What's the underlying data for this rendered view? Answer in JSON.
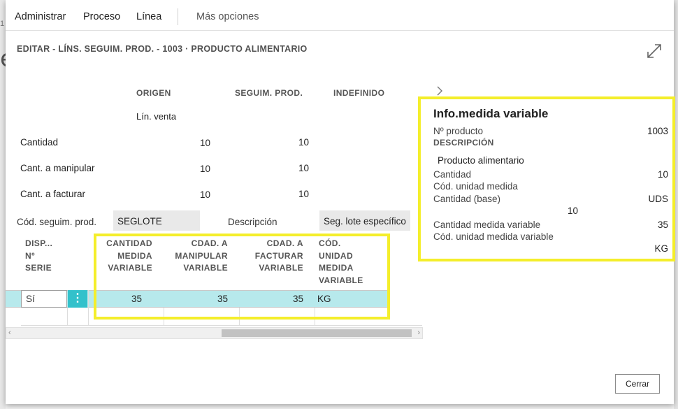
{
  "actions": [
    "Administrar",
    "Proceso",
    "Línea",
    "Más opciones"
  ],
  "dialog": {
    "title": "EDITAR - LÍNS. SEGUIM. PROD. - 1003 · PRODUCTO ALIMENTARIO"
  },
  "summary": {
    "columns": [
      "ORIGEN",
      "SEGUIM. PROD.",
      "INDEFINIDO"
    ],
    "origin_sub": "Lín. venta",
    "rows": [
      {
        "label": "Cantidad",
        "origen": "10",
        "seguim": "10"
      },
      {
        "label": "Cant. a manipular",
        "origen": "10",
        "seguim": "10"
      },
      {
        "label": "Cant. a facturar",
        "origen": "10",
        "seguim": "10"
      }
    ]
  },
  "fields": {
    "cod_label": "Cód. seguim. prod.",
    "cod_value": "SEGLOTE",
    "desc_label": "Descripción",
    "desc_value": "Seg. lote específico"
  },
  "grid": {
    "headers": {
      "disp": "DISP... Nº SERIE",
      "cantidad": "CANTIDAD MEDIDA VARIABLE",
      "cdad_manipular": "CDAD. A MANIPULAR VARIABLE",
      "cdad_facturar": "CDAD. A FACTURAR VARIABLE",
      "cod_unidad": "CÓD. UNIDAD MEDIDA VARIABLE"
    },
    "row": {
      "disp": "Sí",
      "menu": "⋮",
      "cantidad": "35",
      "cdad_manipular": "35",
      "cdad_facturar": "35",
      "cod_unidad": "KG"
    }
  },
  "factbox": {
    "title": "Info.medida variable",
    "no_producto_label": "Nº producto",
    "no_producto_value": "1003",
    "descripcion_caption": "DESCRIPCIÓN",
    "descripcion_value": "Producto alimentario",
    "cantidad_label": "Cantidad",
    "cantidad_value": "10",
    "cod_unidad_label": "Cód. unidad medida",
    "cantidad_base_label": "Cantidad (base)",
    "cod_unidad_value": "UDS",
    "cantidad_base_value": "10",
    "cant_medida_var_label": "Cantidad medida variable",
    "cant_medida_var_value": "35",
    "cod_unidad_var_label": "Cód. unidad medida variable",
    "cod_unidad_var_value": "KG"
  },
  "buttons": {
    "close": "Cerrar"
  },
  "background": {
    "left_number": "1",
    "left_glyph": "e"
  },
  "colors": {
    "highlight": "#f4ee2b",
    "row_selected": "#b7e9ec",
    "row_menu": "#33c1cb"
  }
}
